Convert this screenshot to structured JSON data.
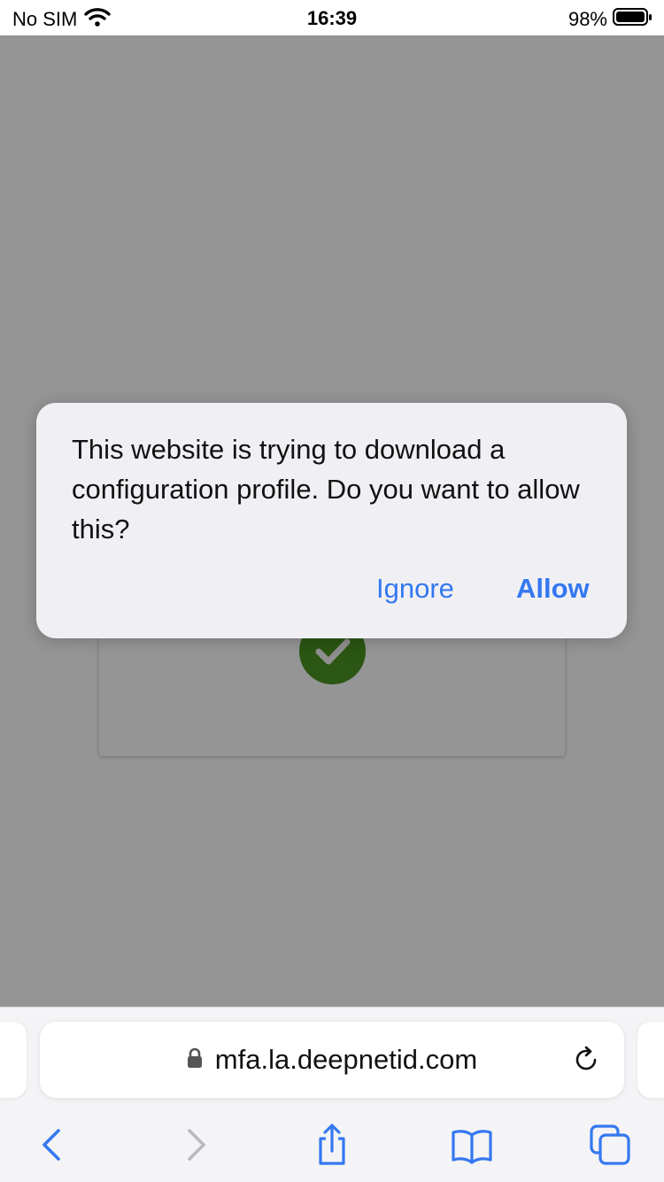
{
  "status_bar": {
    "carrier": "No SIM",
    "time": "16:39",
    "battery_percent": "98%",
    "icons": [
      "wifi-icon",
      "battery-icon"
    ]
  },
  "page": {
    "overlay_dim": true,
    "status_badge_icon": "checkmark-icon",
    "status_badge_color": "#2b5613"
  },
  "alert": {
    "message": "This website is trying to download a configuration profile. Do you want to allow this?",
    "ignore_label": "Ignore",
    "allow_label": "Allow",
    "button_color": "#3478f0"
  },
  "safari": {
    "url": "mfa.la.deepnetid.com",
    "address_icons": [
      "lock-icon",
      "reload-icon"
    ],
    "toolbar_icons": [
      "back-icon",
      "forward-icon",
      "share-icon",
      "bookmarks-icon",
      "tabs-icon"
    ]
  }
}
